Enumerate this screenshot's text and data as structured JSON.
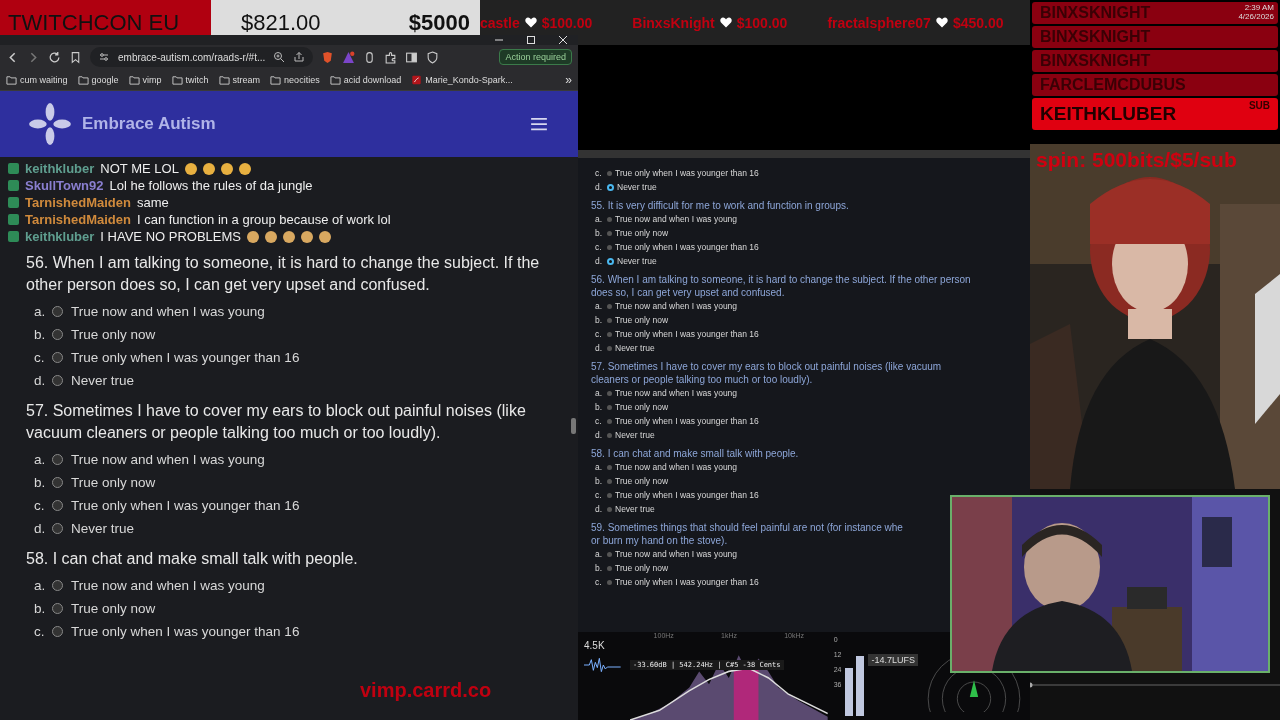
{
  "goal_bar": {
    "label": "TWITCHCON EU",
    "current": "$821.00",
    "target": "$5000"
  },
  "ticker": [
    {
      "name": "castle",
      "amount": "$100.00"
    },
    {
      "name": "BinxsKnight",
      "amount": "$100.00"
    },
    {
      "name": "fractalsphere07",
      "amount": "$450.00"
    }
  ],
  "browser": {
    "url": "embrace-autism.com/raads-r/#t...",
    "action": "Action required",
    "site_title": "Embrace Autism",
    "bookmarks": [
      {
        "label": "cum waiting",
        "kind": "folder"
      },
      {
        "label": "google",
        "kind": "folder"
      },
      {
        "label": "vimp",
        "kind": "folder"
      },
      {
        "label": "twitch",
        "kind": "folder"
      },
      {
        "label": "stream",
        "kind": "folder"
      },
      {
        "label": "neocities",
        "kind": "folder"
      },
      {
        "label": "acid download",
        "kind": "folder"
      },
      {
        "label": "Marie_Kondo-Spark...",
        "kind": "pdf"
      }
    ],
    "more": "»"
  },
  "chat": [
    {
      "user": "keithkluber",
      "color": "#5f9e8f",
      "message": "NOT ME LOL",
      "emotes": [
        {
          "kind": "laugh"
        },
        {
          "kind": "laugh"
        },
        {
          "kind": "laugh"
        },
        {
          "kind": "laugh"
        }
      ]
    },
    {
      "user": "SkullTown92",
      "color": "#8a7fd0",
      "message": "Lol he follows the rules of da jungle"
    },
    {
      "user": "TarnishedMaiden",
      "color": "#d08a3c",
      "message": "same"
    },
    {
      "user": "TarnishedMaiden",
      "color": "#d08a3c",
      "message": "I can function in a group because of work lol"
    },
    {
      "user": "keithkluber",
      "color": "#5f9e8f",
      "message": "I HAVE NO PROBLEMS",
      "emotes": [
        {
          "kind": "smile"
        },
        {
          "kind": "smile"
        },
        {
          "kind": "smile"
        },
        {
          "kind": "smile"
        },
        {
          "kind": "smile"
        }
      ]
    }
  ],
  "page_questions": [
    {
      "number": "56.",
      "text": "When I am talking to someone, it is hard to change the subject. If the other person does so, I can get very upset and confused.",
      "options": [
        {
          "letter": "a.",
          "label": "True now and when I was young",
          "selected": false
        },
        {
          "letter": "b.",
          "label": "True only now",
          "selected": false
        },
        {
          "letter": "c.",
          "label": "True only when I was younger than 16",
          "selected": false
        },
        {
          "letter": "d.",
          "label": "Never true",
          "selected": false
        }
      ]
    },
    {
      "number": "57.",
      "text": "Sometimes I have to cover my ears to block out painful noises (like vacuum cleaners or people talking too much or too loudly).",
      "options": [
        {
          "letter": "a.",
          "label": "True now and when I was young",
          "selected": false
        },
        {
          "letter": "b.",
          "label": "True only now",
          "selected": false
        },
        {
          "letter": "c.",
          "label": "True only when I was younger than 16",
          "selected": false
        },
        {
          "letter": "d.",
          "label": "Never true",
          "selected": false
        }
      ]
    },
    {
      "number": "58.",
      "text": "I can chat and make small talk with people.",
      "options": [
        {
          "letter": "a.",
          "label": "True now and when I was young",
          "selected": false
        },
        {
          "letter": "b.",
          "label": "True only now",
          "selected": false
        },
        {
          "letter": "c.",
          "label": "True only when I was younger than 16",
          "selected": false
        }
      ]
    }
  ],
  "preview_questions": [
    {
      "options": [
        {
          "letter": "c.",
          "label": "True only when I was younger than 16",
          "selected": false
        },
        {
          "letter": "d.",
          "label": "Never true",
          "selected": true
        }
      ]
    },
    {
      "lines": [
        "55. It is very difficult for me to work and function in groups."
      ],
      "options": [
        {
          "letter": "a.",
          "label": "True now and when I was young",
          "selected": false
        },
        {
          "letter": "b.",
          "label": "True only now",
          "selected": false
        },
        {
          "letter": "c.",
          "label": "True only when I was younger than 16",
          "selected": false
        },
        {
          "letter": "d.",
          "label": "Never true",
          "selected": true
        }
      ]
    },
    {
      "lines": [
        "56. When I am talking to someone, it is hard to change the subject. If the other person",
        "does so, I can get very upset and confused."
      ],
      "options": [
        {
          "letter": "a.",
          "label": "True now and when I was young",
          "selected": false
        },
        {
          "letter": "b.",
          "label": "True only now",
          "selected": false
        },
        {
          "letter": "c.",
          "label": "True only when I was younger than 16",
          "selected": false
        },
        {
          "letter": "d.",
          "label": "Never true",
          "selected": false
        }
      ]
    },
    {
      "lines": [
        "57. Sometimes I have to cover my ears to block out painful noises (like vacuum",
        "cleaners or people talking too much or too loudly)."
      ],
      "options": [
        {
          "letter": "a.",
          "label": "True now and when I was young",
          "selected": false
        },
        {
          "letter": "b.",
          "label": "True only now",
          "selected": false
        },
        {
          "letter": "c.",
          "label": "True only when I was younger than 16",
          "selected": false
        },
        {
          "letter": "d.",
          "label": "Never true",
          "selected": false
        }
      ]
    },
    {
      "lines": [
        "58. I can chat and make small talk with people."
      ],
      "options": [
        {
          "letter": "a.",
          "label": "True now and when I was young",
          "selected": false
        },
        {
          "letter": "b.",
          "label": "True only now",
          "selected": false
        },
        {
          "letter": "c.",
          "label": "True only when I was younger than 16",
          "selected": false
        },
        {
          "letter": "d.",
          "label": "Never true",
          "selected": false
        }
      ]
    },
    {
      "lines": [
        "59. Sometimes things that should feel painful are not (for instance whe",
        "or burn my hand on the stove)."
      ],
      "options": [
        {
          "letter": "a.",
          "label": "True now and when I was young",
          "selected": false
        },
        {
          "letter": "b.",
          "label": "True only now",
          "selected": false
        },
        {
          "letter": "c.",
          "label": "True only when I was younger than 16",
          "selected": false
        }
      ]
    }
  ],
  "alerts": [
    {
      "name": "BINXSKNIGHT",
      "latest": false
    },
    {
      "name": "BINXSKNIGHT",
      "latest": false
    },
    {
      "name": "BINXSKNIGHT",
      "latest": false
    },
    {
      "name": "FARCLEMCDUBUS",
      "latest": false
    },
    {
      "name": "KEITHKLUBER",
      "latest": true,
      "note": "SUB"
    }
  ],
  "clock": {
    "time": "2:39 AM",
    "date": "4/26/2026"
  },
  "spin_text": "spin: 500bits/$5/sub",
  "audio": {
    "peak": "4.5K",
    "freq_labels": [
      "100Hz",
      "1kHz",
      "10kHz"
    ],
    "readout": "-33.60dB | 542.24Hz | C#5 -38 Cents",
    "loudness": "-14.7LUFS",
    "scale": [
      "0",
      "12",
      "24",
      "36"
    ]
  },
  "site_link": "vimp.carrd.co"
}
